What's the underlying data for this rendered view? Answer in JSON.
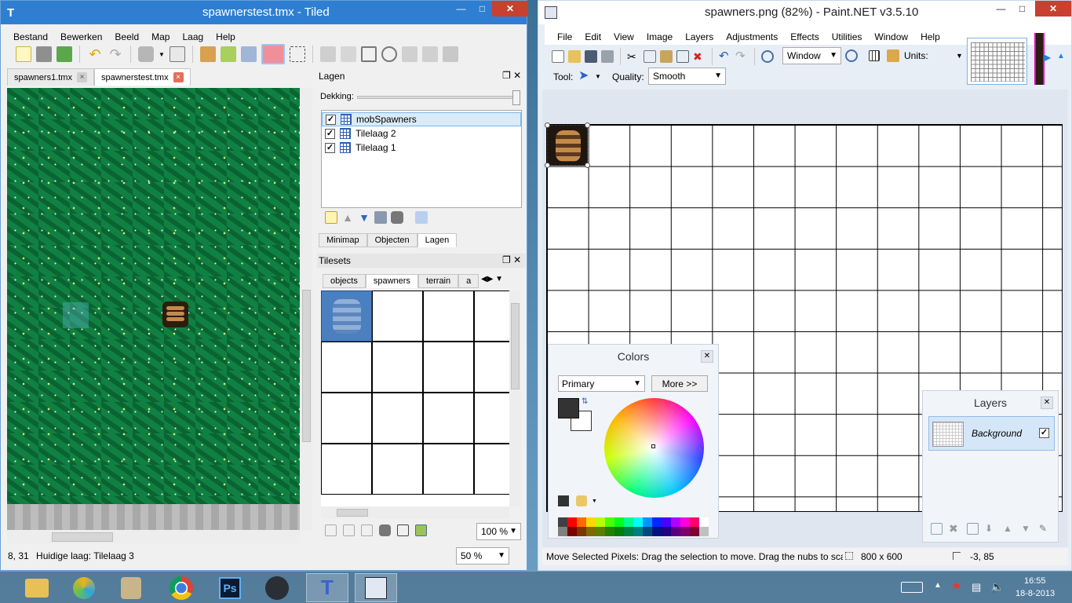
{
  "tiled": {
    "title": "spawnerstest.tmx - Tiled",
    "menu": [
      "Bestand",
      "Bewerken",
      "Beeld",
      "Map",
      "Laag",
      "Help"
    ],
    "doc_tabs": [
      {
        "label": "spawners1.tmx",
        "active": false
      },
      {
        "label": "spawnerstest.tmx",
        "active": true
      }
    ],
    "layers_panel": {
      "title": "Lagen",
      "opacity_label": "Dekking:",
      "layers": [
        {
          "name": "mobSpawners",
          "visible": true,
          "selected": true
        },
        {
          "name": "Tilelaag 2",
          "visible": true,
          "selected": false
        },
        {
          "name": "Tilelaag 1",
          "visible": true,
          "selected": false
        }
      ],
      "bottom_tabs": [
        {
          "label": "Minimap",
          "active": false
        },
        {
          "label": "Objecten",
          "active": false
        },
        {
          "label": "Lagen",
          "active": true
        }
      ]
    },
    "tilesets_panel": {
      "title": "Tilesets",
      "tabs": [
        {
          "label": "objects",
          "active": false
        },
        {
          "label": "spawners",
          "active": true
        },
        {
          "label": "terrain",
          "active": false
        },
        {
          "label": "a",
          "active": false
        }
      ],
      "zoom": "100 %"
    },
    "status": {
      "coords": "8, 31",
      "current_layer": "Huidige laag: Tilelaag 3",
      "zoom": "50 %"
    }
  },
  "paintnet": {
    "title": "spawners.png (82%) - Paint.NET v3.5.10",
    "menu": [
      "File",
      "Edit",
      "View",
      "Image",
      "Layers",
      "Adjustments",
      "Effects",
      "Utilities",
      "Window",
      "Help"
    ],
    "zoom_mode": "Window",
    "units_label": "Units:",
    "tool_label": "Tool:",
    "quality_label": "Quality:",
    "quality_value": "Smooth",
    "colors_window": {
      "title": "Colors",
      "mode": "Primary",
      "more_button": "More >>",
      "primary_color": "#333333",
      "secondary_color": "#ffffff",
      "palette": [
        "#404040",
        "#ff0000",
        "#ff6a00",
        "#ffd800",
        "#b6ff00",
        "#4cff00",
        "#00ff21",
        "#00ff90",
        "#00ffff",
        "#0094ff",
        "#0026ff",
        "#4800ff",
        "#b200ff",
        "#ff00dc",
        "#ff006e",
        "#ffffff",
        "#808080",
        "#7f0000",
        "#7f3300",
        "#7f6a00",
        "#5b7f00",
        "#267f00",
        "#007f0e",
        "#007f46",
        "#007f7f",
        "#004a7f",
        "#00137f",
        "#21007f",
        "#57007f",
        "#7f006e",
        "#7f0037",
        "#c0c0c0"
      ]
    },
    "layers_window": {
      "title": "Layers",
      "layer_name": "Background",
      "visible": true
    },
    "status": {
      "hint": "Move Selected Pixels: Drag the selection to move. Drag the nubs to scale.",
      "image_size": "800 x 600",
      "cursor_pos": "-3, 85"
    }
  },
  "taskbar": {
    "apps": [
      "file-explorer",
      "ie-browser",
      "scroll-app",
      "chrome",
      "photoshop",
      "steam",
      "tiled",
      "paintnet"
    ],
    "active_apps": [
      "tiled",
      "paintnet"
    ],
    "time": "16:55",
    "date": "18-8-2013"
  }
}
